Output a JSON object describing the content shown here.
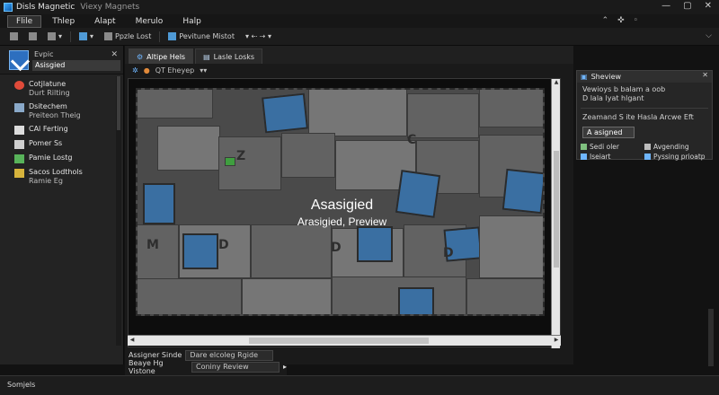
{
  "window": {
    "title": "Disls Magnetic",
    "subtitle": "Viexy Magnets",
    "controls": [
      "—",
      "▢",
      "✕"
    ]
  },
  "menu": {
    "items": [
      "Flile",
      "Thlep",
      "Alapt",
      "Merulo",
      "Halp"
    ],
    "active_index": 0,
    "right_icons": [
      "⌃",
      "✜",
      "◦"
    ]
  },
  "toolbar": {
    "button1": "Ppzle Lost",
    "button2": "Pevitune Mistot",
    "right_glyph": "⌵"
  },
  "left_panel": {
    "title": "Evpic",
    "selected": "Asisgied",
    "close": "✕",
    "items": [
      {
        "line1": "Cotjlatune",
        "line2": "Durt Rilting",
        "icon": "palette-icon",
        "color": "#e04b3a"
      },
      {
        "line1": "Dsitechem",
        "line2": "Preiteon Theig",
        "icon": "monitor-icon",
        "color": "#8aa9c9"
      },
      {
        "line1": "CAl Ferting",
        "line2": "",
        "icon": "document-icon",
        "color": "#dcdcdc"
      },
      {
        "line1": "Pomer Ss",
        "line2": "",
        "icon": "layers-icon",
        "color": "#cfcfcf"
      },
      {
        "line1": "Pamie Lostg",
        "line2": "",
        "icon": "image-icon",
        "color": "#58b35a"
      },
      {
        "line1": "Sacos Lodthols",
        "line2": "Ramie Eg",
        "icon": "grid-icon",
        "color": "#d6b33c"
      }
    ]
  },
  "center": {
    "tabs": [
      {
        "label": "Altipe Hels",
        "icon": "gear-icon"
      },
      {
        "label": "Lasle Losks",
        "icon": "layers-icon"
      }
    ],
    "subbar": {
      "label": "QT Eheyep",
      "glyph": "▾▾"
    },
    "canvas": {
      "title": "Asasigied",
      "subtitle": "Arasigied, Preview",
      "letters": [
        "C",
        "D",
        "M",
        "D",
        "D",
        "Z"
      ]
    }
  },
  "bottom": {
    "row1_label": "Assigner Sinde",
    "row1_value": "Dare elcoleg Rgide",
    "row2_label": "Beaye Hg Vistone",
    "row2_value": "Coniny Review",
    "row2_glyph": "▸"
  },
  "right_panel": {
    "title": "Sheview",
    "close": "✕",
    "line1": "Vewioys b balam a oob",
    "line2": "D lala lyat hlgant",
    "line3": "Zeamand S ite Hasla Arcwe Eft",
    "button": "A asigned",
    "cells": [
      {
        "label": "Sedi oler",
        "icon": "edit-icon"
      },
      {
        "label": "Avgending",
        "icon": "pen-icon"
      },
      {
        "label": "Iseiart",
        "icon": "arrow-icon"
      },
      {
        "label": "Pyssing prioatp",
        "icon": "sort-icon"
      }
    ]
  },
  "status": {
    "text": "Somjels"
  }
}
